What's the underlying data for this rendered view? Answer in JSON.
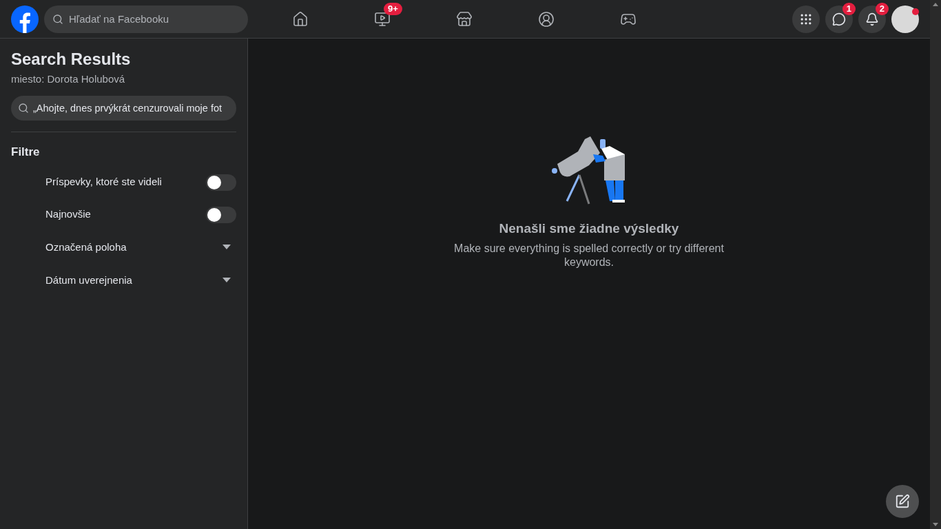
{
  "header": {
    "search": {
      "placeholder": "Hľadať na Facebooku"
    },
    "nav": [
      {
        "kind": "home",
        "selected": false
      },
      {
        "kind": "video",
        "selected": false,
        "badge": "9+"
      },
      {
        "kind": "store",
        "selected": false
      },
      {
        "kind": "groups",
        "selected": false
      },
      {
        "kind": "gaming",
        "selected": false
      }
    ],
    "actions": [
      {
        "kind": "menu"
      },
      {
        "kind": "messenger",
        "badge": "1"
      },
      {
        "kind": "bell",
        "badge": "2"
      }
    ],
    "avatar": {
      "unread": true
    }
  },
  "sidebar": {
    "title": "Search Results",
    "subtitle": "miesto: Dorota Holubová",
    "query": "„Ahojte, dnes prvýkrát cenzurovali moje fot",
    "filters_title": "Filtre",
    "filters": [
      {
        "kind": "toggle",
        "label": "Príspevky, ktoré ste videli",
        "on": false
      },
      {
        "kind": "toggle",
        "label": "Najnovšie",
        "on": false
      },
      {
        "kind": "dropdown",
        "label": "Označená poloha"
      },
      {
        "kind": "dropdown",
        "label": "Dátum uverejnenia"
      }
    ]
  },
  "empty_state": {
    "title": "Nenašli sme žiadne výsledky",
    "message": "Make sure everything is spelled correctly or try different keywords."
  }
}
